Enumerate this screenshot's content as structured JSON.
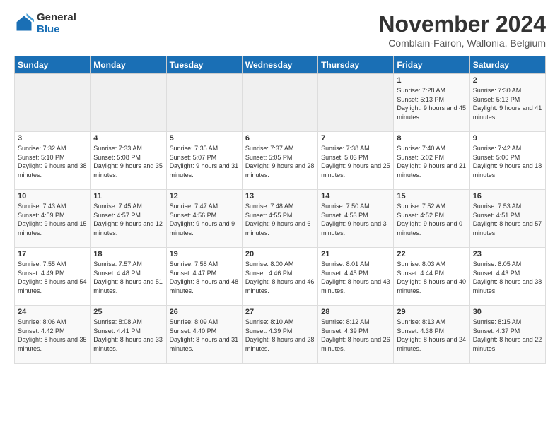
{
  "logo": {
    "line1": "General",
    "line2": "Blue"
  },
  "title": "November 2024",
  "subtitle": "Comblain-Fairon, Wallonia, Belgium",
  "days_of_week": [
    "Sunday",
    "Monday",
    "Tuesday",
    "Wednesday",
    "Thursday",
    "Friday",
    "Saturday"
  ],
  "weeks": [
    [
      {
        "day": "",
        "info": ""
      },
      {
        "day": "",
        "info": ""
      },
      {
        "day": "",
        "info": ""
      },
      {
        "day": "",
        "info": ""
      },
      {
        "day": "",
        "info": ""
      },
      {
        "day": "1",
        "info": "Sunrise: 7:28 AM\nSunset: 5:13 PM\nDaylight: 9 hours and 45 minutes."
      },
      {
        "day": "2",
        "info": "Sunrise: 7:30 AM\nSunset: 5:12 PM\nDaylight: 9 hours and 41 minutes."
      }
    ],
    [
      {
        "day": "3",
        "info": "Sunrise: 7:32 AM\nSunset: 5:10 PM\nDaylight: 9 hours and 38 minutes."
      },
      {
        "day": "4",
        "info": "Sunrise: 7:33 AM\nSunset: 5:08 PM\nDaylight: 9 hours and 35 minutes."
      },
      {
        "day": "5",
        "info": "Sunrise: 7:35 AM\nSunset: 5:07 PM\nDaylight: 9 hours and 31 minutes."
      },
      {
        "day": "6",
        "info": "Sunrise: 7:37 AM\nSunset: 5:05 PM\nDaylight: 9 hours and 28 minutes."
      },
      {
        "day": "7",
        "info": "Sunrise: 7:38 AM\nSunset: 5:03 PM\nDaylight: 9 hours and 25 minutes."
      },
      {
        "day": "8",
        "info": "Sunrise: 7:40 AM\nSunset: 5:02 PM\nDaylight: 9 hours and 21 minutes."
      },
      {
        "day": "9",
        "info": "Sunrise: 7:42 AM\nSunset: 5:00 PM\nDaylight: 9 hours and 18 minutes."
      }
    ],
    [
      {
        "day": "10",
        "info": "Sunrise: 7:43 AM\nSunset: 4:59 PM\nDaylight: 9 hours and 15 minutes."
      },
      {
        "day": "11",
        "info": "Sunrise: 7:45 AM\nSunset: 4:57 PM\nDaylight: 9 hours and 12 minutes."
      },
      {
        "day": "12",
        "info": "Sunrise: 7:47 AM\nSunset: 4:56 PM\nDaylight: 9 hours and 9 minutes."
      },
      {
        "day": "13",
        "info": "Sunrise: 7:48 AM\nSunset: 4:55 PM\nDaylight: 9 hours and 6 minutes."
      },
      {
        "day": "14",
        "info": "Sunrise: 7:50 AM\nSunset: 4:53 PM\nDaylight: 9 hours and 3 minutes."
      },
      {
        "day": "15",
        "info": "Sunrise: 7:52 AM\nSunset: 4:52 PM\nDaylight: 9 hours and 0 minutes."
      },
      {
        "day": "16",
        "info": "Sunrise: 7:53 AM\nSunset: 4:51 PM\nDaylight: 8 hours and 57 minutes."
      }
    ],
    [
      {
        "day": "17",
        "info": "Sunrise: 7:55 AM\nSunset: 4:49 PM\nDaylight: 8 hours and 54 minutes."
      },
      {
        "day": "18",
        "info": "Sunrise: 7:57 AM\nSunset: 4:48 PM\nDaylight: 8 hours and 51 minutes."
      },
      {
        "day": "19",
        "info": "Sunrise: 7:58 AM\nSunset: 4:47 PM\nDaylight: 8 hours and 48 minutes."
      },
      {
        "day": "20",
        "info": "Sunrise: 8:00 AM\nSunset: 4:46 PM\nDaylight: 8 hours and 46 minutes."
      },
      {
        "day": "21",
        "info": "Sunrise: 8:01 AM\nSunset: 4:45 PM\nDaylight: 8 hours and 43 minutes."
      },
      {
        "day": "22",
        "info": "Sunrise: 8:03 AM\nSunset: 4:44 PM\nDaylight: 8 hours and 40 minutes."
      },
      {
        "day": "23",
        "info": "Sunrise: 8:05 AM\nSunset: 4:43 PM\nDaylight: 8 hours and 38 minutes."
      }
    ],
    [
      {
        "day": "24",
        "info": "Sunrise: 8:06 AM\nSunset: 4:42 PM\nDaylight: 8 hours and 35 minutes."
      },
      {
        "day": "25",
        "info": "Sunrise: 8:08 AM\nSunset: 4:41 PM\nDaylight: 8 hours and 33 minutes."
      },
      {
        "day": "26",
        "info": "Sunrise: 8:09 AM\nSunset: 4:40 PM\nDaylight: 8 hours and 31 minutes."
      },
      {
        "day": "27",
        "info": "Sunrise: 8:10 AM\nSunset: 4:39 PM\nDaylight: 8 hours and 28 minutes."
      },
      {
        "day": "28",
        "info": "Sunrise: 8:12 AM\nSunset: 4:39 PM\nDaylight: 8 hours and 26 minutes."
      },
      {
        "day": "29",
        "info": "Sunrise: 8:13 AM\nSunset: 4:38 PM\nDaylight: 8 hours and 24 minutes."
      },
      {
        "day": "30",
        "info": "Sunrise: 8:15 AM\nSunset: 4:37 PM\nDaylight: 8 hours and 22 minutes."
      }
    ]
  ]
}
